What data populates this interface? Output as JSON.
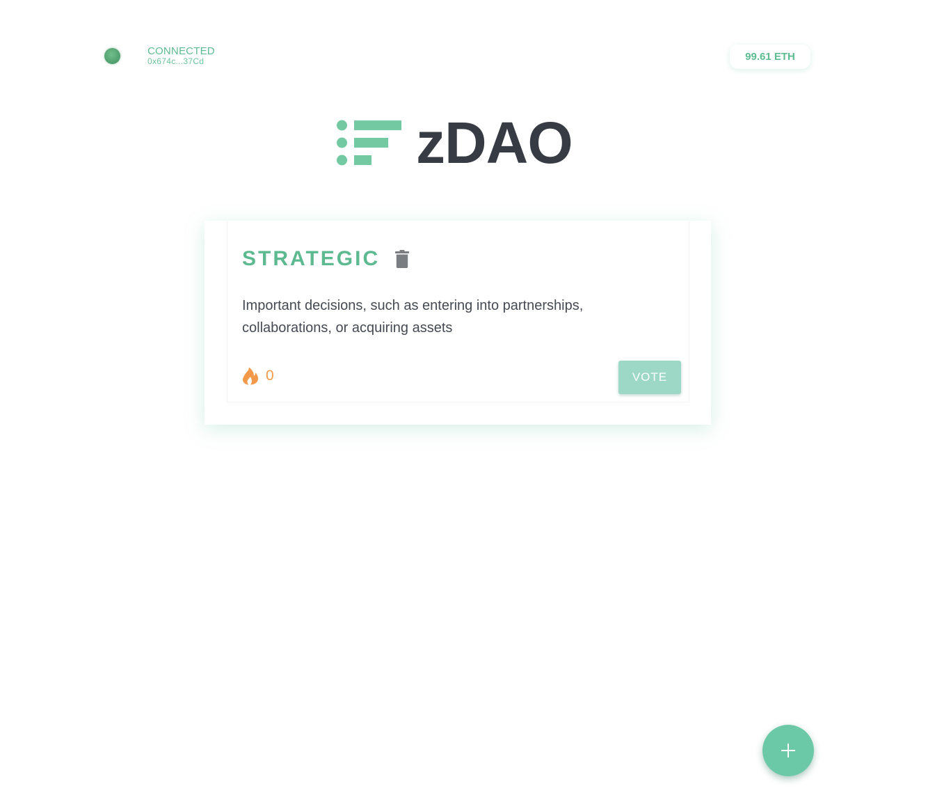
{
  "header": {
    "status_label": "CONNECTED",
    "wallet_address": "0x674c...37Cd",
    "balance": "99.61 ETH"
  },
  "logo": {
    "text": "zDAO",
    "icon": "logo-bars-icon"
  },
  "proposal_card": {
    "title": "STRATEGIC",
    "description": "Important decisions, such as entering into partnerships, collaborations, or acquiring assets",
    "vote_count": "0",
    "vote_button_label": "VOTE",
    "delete_icon": "trash-icon",
    "vote_count_icon": "flame-icon"
  },
  "fab": {
    "icon": "plus-icon"
  },
  "colors": {
    "accent": "#5dbb91",
    "accent_light": "#9dd8c6",
    "fab": "#6cc9a8",
    "text_dark": "#373b43",
    "flame": "#f29a4a",
    "connected_dot": "#5aa877"
  }
}
